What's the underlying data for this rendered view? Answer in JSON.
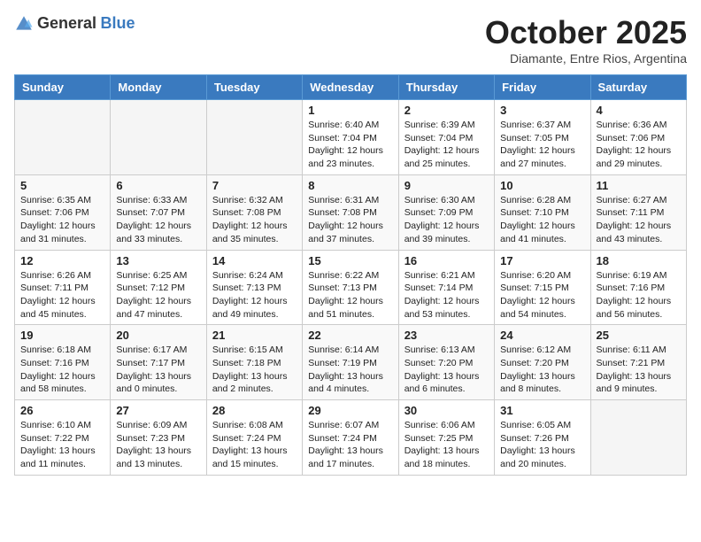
{
  "header": {
    "logo_general": "General",
    "logo_blue": "Blue",
    "month_title": "October 2025",
    "location": "Diamante, Entre Rios, Argentina"
  },
  "weekdays": [
    "Sunday",
    "Monday",
    "Tuesday",
    "Wednesday",
    "Thursday",
    "Friday",
    "Saturday"
  ],
  "weeks": [
    [
      {
        "day": "",
        "info": ""
      },
      {
        "day": "",
        "info": ""
      },
      {
        "day": "",
        "info": ""
      },
      {
        "day": "1",
        "info": "Sunrise: 6:40 AM\nSunset: 7:04 PM\nDaylight: 12 hours\nand 23 minutes."
      },
      {
        "day": "2",
        "info": "Sunrise: 6:39 AM\nSunset: 7:04 PM\nDaylight: 12 hours\nand 25 minutes."
      },
      {
        "day": "3",
        "info": "Sunrise: 6:37 AM\nSunset: 7:05 PM\nDaylight: 12 hours\nand 27 minutes."
      },
      {
        "day": "4",
        "info": "Sunrise: 6:36 AM\nSunset: 7:06 PM\nDaylight: 12 hours\nand 29 minutes."
      }
    ],
    [
      {
        "day": "5",
        "info": "Sunrise: 6:35 AM\nSunset: 7:06 PM\nDaylight: 12 hours\nand 31 minutes."
      },
      {
        "day": "6",
        "info": "Sunrise: 6:33 AM\nSunset: 7:07 PM\nDaylight: 12 hours\nand 33 minutes."
      },
      {
        "day": "7",
        "info": "Sunrise: 6:32 AM\nSunset: 7:08 PM\nDaylight: 12 hours\nand 35 minutes."
      },
      {
        "day": "8",
        "info": "Sunrise: 6:31 AM\nSunset: 7:08 PM\nDaylight: 12 hours\nand 37 minutes."
      },
      {
        "day": "9",
        "info": "Sunrise: 6:30 AM\nSunset: 7:09 PM\nDaylight: 12 hours\nand 39 minutes."
      },
      {
        "day": "10",
        "info": "Sunrise: 6:28 AM\nSunset: 7:10 PM\nDaylight: 12 hours\nand 41 minutes."
      },
      {
        "day": "11",
        "info": "Sunrise: 6:27 AM\nSunset: 7:11 PM\nDaylight: 12 hours\nand 43 minutes."
      }
    ],
    [
      {
        "day": "12",
        "info": "Sunrise: 6:26 AM\nSunset: 7:11 PM\nDaylight: 12 hours\nand 45 minutes."
      },
      {
        "day": "13",
        "info": "Sunrise: 6:25 AM\nSunset: 7:12 PM\nDaylight: 12 hours\nand 47 minutes."
      },
      {
        "day": "14",
        "info": "Sunrise: 6:24 AM\nSunset: 7:13 PM\nDaylight: 12 hours\nand 49 minutes."
      },
      {
        "day": "15",
        "info": "Sunrise: 6:22 AM\nSunset: 7:13 PM\nDaylight: 12 hours\nand 51 minutes."
      },
      {
        "day": "16",
        "info": "Sunrise: 6:21 AM\nSunset: 7:14 PM\nDaylight: 12 hours\nand 53 minutes."
      },
      {
        "day": "17",
        "info": "Sunrise: 6:20 AM\nSunset: 7:15 PM\nDaylight: 12 hours\nand 54 minutes."
      },
      {
        "day": "18",
        "info": "Sunrise: 6:19 AM\nSunset: 7:16 PM\nDaylight: 12 hours\nand 56 minutes."
      }
    ],
    [
      {
        "day": "19",
        "info": "Sunrise: 6:18 AM\nSunset: 7:16 PM\nDaylight: 12 hours\nand 58 minutes."
      },
      {
        "day": "20",
        "info": "Sunrise: 6:17 AM\nSunset: 7:17 PM\nDaylight: 13 hours\nand 0 minutes."
      },
      {
        "day": "21",
        "info": "Sunrise: 6:15 AM\nSunset: 7:18 PM\nDaylight: 13 hours\nand 2 minutes."
      },
      {
        "day": "22",
        "info": "Sunrise: 6:14 AM\nSunset: 7:19 PM\nDaylight: 13 hours\nand 4 minutes."
      },
      {
        "day": "23",
        "info": "Sunrise: 6:13 AM\nSunset: 7:20 PM\nDaylight: 13 hours\nand 6 minutes."
      },
      {
        "day": "24",
        "info": "Sunrise: 6:12 AM\nSunset: 7:20 PM\nDaylight: 13 hours\nand 8 minutes."
      },
      {
        "day": "25",
        "info": "Sunrise: 6:11 AM\nSunset: 7:21 PM\nDaylight: 13 hours\nand 9 minutes."
      }
    ],
    [
      {
        "day": "26",
        "info": "Sunrise: 6:10 AM\nSunset: 7:22 PM\nDaylight: 13 hours\nand 11 minutes."
      },
      {
        "day": "27",
        "info": "Sunrise: 6:09 AM\nSunset: 7:23 PM\nDaylight: 13 hours\nand 13 minutes."
      },
      {
        "day": "28",
        "info": "Sunrise: 6:08 AM\nSunset: 7:24 PM\nDaylight: 13 hours\nand 15 minutes."
      },
      {
        "day": "29",
        "info": "Sunrise: 6:07 AM\nSunset: 7:24 PM\nDaylight: 13 hours\nand 17 minutes."
      },
      {
        "day": "30",
        "info": "Sunrise: 6:06 AM\nSunset: 7:25 PM\nDaylight: 13 hours\nand 18 minutes."
      },
      {
        "day": "31",
        "info": "Sunrise: 6:05 AM\nSunset: 7:26 PM\nDaylight: 13 hours\nand 20 minutes."
      },
      {
        "day": "",
        "info": ""
      }
    ]
  ]
}
